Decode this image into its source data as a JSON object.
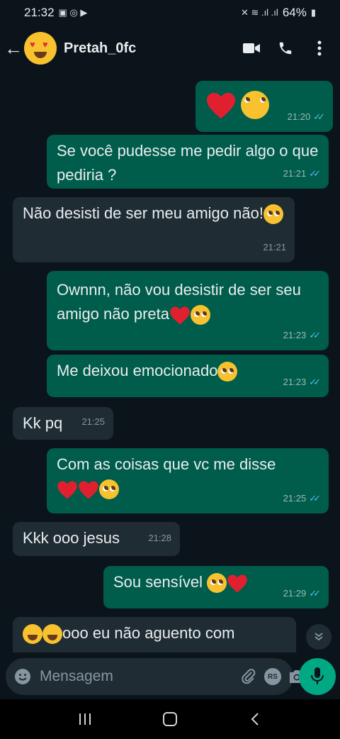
{
  "status_bar": {
    "time": "21:32",
    "battery": "64%"
  },
  "header": {
    "contact_name": "Pretah_0fc"
  },
  "messages": [
    {
      "dir": "out",
      "time": "21:20",
      "parts": [
        {
          "emoji": "heart"
        },
        {
          "emoji": "pleading"
        }
      ]
    },
    {
      "dir": "out",
      "time": "21:21",
      "text": "Se você pudesse me pedir algo o que pediria ?"
    },
    {
      "dir": "in",
      "time": "21:21",
      "text": "Não desisti de ser meu amigo não!"
    },
    {
      "dir": "out",
      "time": "21:23",
      "text": "Ownnn, não vou desistir de ser seu amigo não preta"
    },
    {
      "dir": "out",
      "time": "21:23",
      "text": "Me deixou emocionado"
    },
    {
      "dir": "in",
      "time": "21:25",
      "text": "Kk pq"
    },
    {
      "dir": "out",
      "time": "21:25",
      "text": "Com as coisas que vc me disse"
    },
    {
      "dir": "in",
      "time": "21:28",
      "text": "Kkk ooo jesus"
    },
    {
      "dir": "out",
      "time": "21:29",
      "text": "Sou sensível"
    },
    {
      "dir": "in",
      "time": "",
      "text": "ooo eu não  aguento com"
    }
  ],
  "composer": {
    "placeholder": "Mensagem",
    "rs_label": "RS"
  },
  "icons": {
    "back": "arrow-left-icon",
    "video": "video-camera-icon",
    "call": "phone-icon",
    "menu": "more-vertical-icon",
    "emoji": "emoji-icon",
    "attach": "paperclip-icon",
    "camera": "camera-icon",
    "mic": "microphone-icon"
  },
  "colors": {
    "outgoing_bubble": "#005c4b",
    "incoming_bubble": "#202c33",
    "background": "#0b141a",
    "accent": "#00a884",
    "read_ticks": "#53bdeb"
  }
}
